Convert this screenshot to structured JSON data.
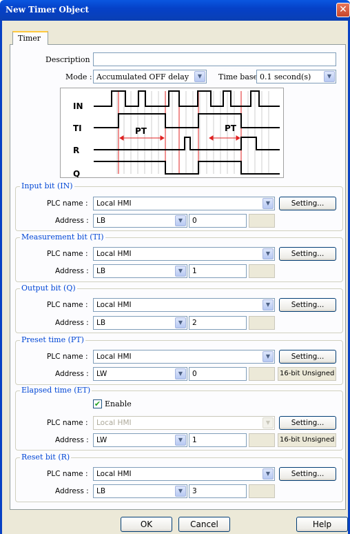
{
  "window": {
    "title": "New  Timer Object",
    "close_glyph": "✕"
  },
  "tab": {
    "label": "Timer"
  },
  "description": {
    "label": "Description :",
    "value": ""
  },
  "mode": {
    "label": "Mode :",
    "value": "Accumulated OFF delay"
  },
  "time_base": {
    "label": "Time base :",
    "value": "0.1 second(s)"
  },
  "diagram": {
    "signals": [
      "IN",
      "TI",
      "R",
      "Q"
    ],
    "pt_label": "PT"
  },
  "labels": {
    "plc_name": "PLC name :",
    "address": "Address :",
    "setting": "Setting..."
  },
  "input_bit": {
    "title": "Input bit (IN)",
    "plc_name": "Local HMI",
    "device": "LB",
    "address": "0",
    "format": ""
  },
  "measurement_bit": {
    "title": "Measurement bit (TI)",
    "plc_name": "Local HMI",
    "device": "LB",
    "address": "1",
    "format": ""
  },
  "output_bit": {
    "title": "Output bit (Q)",
    "plc_name": "Local HMI",
    "device": "LB",
    "address": "2",
    "format": ""
  },
  "preset_time": {
    "title": "Preset time (PT)",
    "plc_name": "Local HMI",
    "device": "LW",
    "address": "0",
    "format": "16-bit Unsigned"
  },
  "elapsed_time": {
    "title": "Elapsed time (ET)",
    "enable_label": "Enable",
    "enabled": true,
    "plc_name": "Local HMI",
    "device": "LW",
    "address": "1",
    "format": "16-bit Unsigned"
  },
  "reset_bit": {
    "title": "Reset bit (R)",
    "plc_name": "Local HMI",
    "device": "LB",
    "address": "3",
    "format": ""
  },
  "footer": {
    "ok": "OK",
    "cancel": "Cancel",
    "help": "Help"
  },
  "colors": {
    "title_bar": "#0a4fd8",
    "group_title": "#0046d5",
    "pulse_red": "#e02020"
  },
  "icons": {
    "combo": "chevron-down-icon",
    "close": "close-icon",
    "check": "checkmark-icon"
  }
}
